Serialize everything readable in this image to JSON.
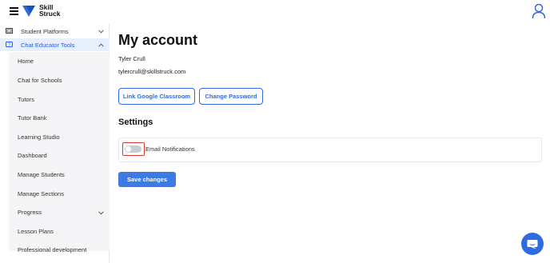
{
  "header": {
    "logo_line1": "Skill",
    "logo_line2": "Struck"
  },
  "sidebar": {
    "student_platforms": "Student Platforms",
    "chat_educator_tools": "Chat Educator Tools",
    "items": [
      "Home",
      "Chat for Schools",
      "Tutors",
      "Tutor Bank",
      "Learning Studio",
      "Dashboard",
      "Manage Students",
      "Manage Sections",
      "Progress",
      "Lesson Plans",
      "Professional development"
    ]
  },
  "main": {
    "title": "My account",
    "user_name": "Tyler Crull",
    "user_email": "tylercrull@skillstruck.com",
    "link_google_label": "Link Google Classroom",
    "change_password_label": "Change Password",
    "settings_heading": "Settings",
    "email_notifications_label": "Email Notifications",
    "email_notifications_enabled": false,
    "save_label": "Save changes"
  },
  "colors": {
    "accent": "#2f6bde",
    "active_bg": "#e7eefc",
    "highlight_border": "#d93a30"
  }
}
